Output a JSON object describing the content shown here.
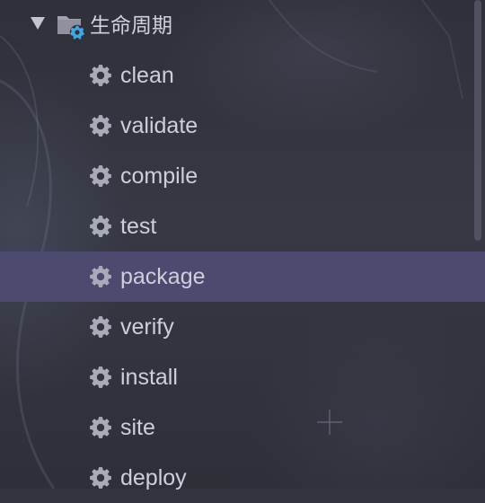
{
  "tree": {
    "parent": {
      "label": "生命周期",
      "expanded": true,
      "toggle_icon": "triangle-down-icon",
      "folder_icon": "folder-gear-icon"
    },
    "items": [
      {
        "label": "clean",
        "icon": "gear-icon",
        "selected": false
      },
      {
        "label": "validate",
        "icon": "gear-icon",
        "selected": false
      },
      {
        "label": "compile",
        "icon": "gear-icon",
        "selected": false
      },
      {
        "label": "test",
        "icon": "gear-icon",
        "selected": false
      },
      {
        "label": "package",
        "icon": "gear-icon",
        "selected": true
      },
      {
        "label": "verify",
        "icon": "gear-icon",
        "selected": false
      },
      {
        "label": "install",
        "icon": "gear-icon",
        "selected": false
      },
      {
        "label": "site",
        "icon": "gear-icon",
        "selected": false
      },
      {
        "label": "deploy",
        "icon": "gear-icon",
        "selected": false
      }
    ]
  },
  "colors": {
    "selection": "#4c4a6e",
    "text": "#cdd0da",
    "gear": "#a9acb8",
    "folder": "#a0a3ae",
    "folder_gear": "#3fa7e3"
  }
}
